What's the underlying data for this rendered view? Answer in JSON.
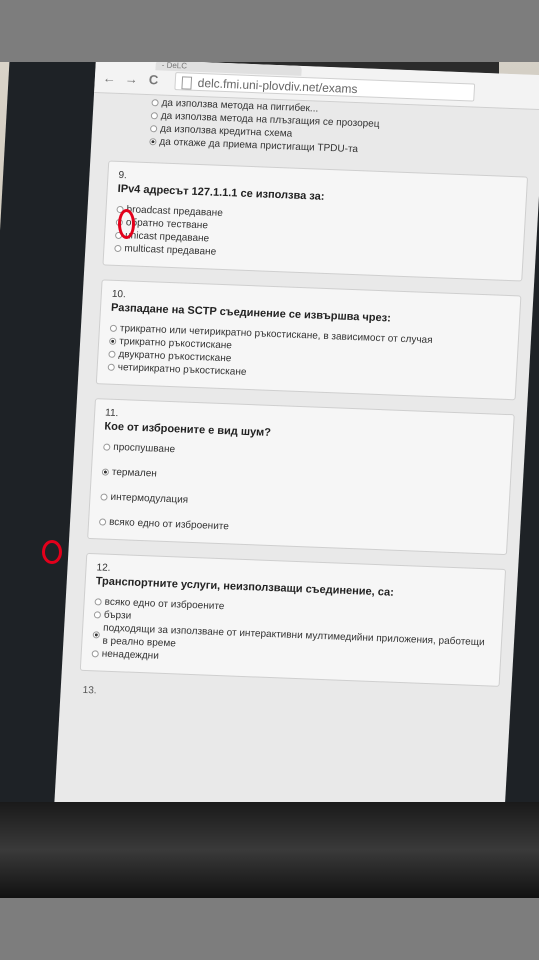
{
  "browser": {
    "tab_title": "- DeLC",
    "back_glyph": "←",
    "forward_glyph": "→",
    "reload_glyph": "C",
    "url": "delc.fmi.uni-plovdiv.net/exams"
  },
  "previous_question_options": [
    {
      "label": "да използва метода на пиггибек...",
      "checked": false
    },
    {
      "label": "да използва метода на плъзгащия се прозорец",
      "checked": false
    },
    {
      "label": "да използва кредитна схема",
      "checked": false
    },
    {
      "label": "да откаже да приема пристигащи TPDU-та",
      "checked": true
    }
  ],
  "questions": [
    {
      "number": "9.",
      "text": "IPv4 адресът 127.1.1.1 се използва за:",
      "options": [
        {
          "label": "broadcast предаване",
          "checked": false
        },
        {
          "label": "обратно тестване",
          "checked": false
        },
        {
          "label": "unicast предаване",
          "checked": false
        },
        {
          "label": "multicast предаване",
          "checked": false
        }
      ]
    },
    {
      "number": "10.",
      "text": "Разпадане на SCTP съединение се извършва чрез:",
      "options": [
        {
          "label": "трикратно или четирикратно ръкостискане, в зависимост от случая",
          "checked": false
        },
        {
          "label": "трикратно ръкостискане",
          "checked": true
        },
        {
          "label": "двукратно ръкостискане",
          "checked": false
        },
        {
          "label": "четирикратно ръкостискане",
          "checked": false
        }
      ]
    },
    {
      "number": "11.",
      "text": "Кое от изброените е вид шум?",
      "options": [
        {
          "label": "проспушване",
          "checked": false
        },
        {
          "label": "термален",
          "checked": true
        },
        {
          "label": "интермодулация",
          "checked": false
        },
        {
          "label": "всяко едно от изброените",
          "checked": false
        }
      ]
    },
    {
      "number": "12.",
      "text": "Транспортните услуги, неизползващи съединение, са:",
      "options": [
        {
          "label": "всяко едно от изброените",
          "checked": false
        },
        {
          "label": "бързи",
          "checked": false
        },
        {
          "label": "подходящи за използване от интерактивни мултимедийни приложения, работещи в реално време",
          "checked": true
        },
        {
          "label": "ненадеждни",
          "checked": false
        }
      ]
    }
  ],
  "next_question_number": "13.",
  "colors": {
    "annotation": "#e3001b",
    "taskbar": "#2a3f55"
  },
  "taskbar_icons": [
    "internet-explorer-icon",
    "folder-icon",
    "media-player-icon",
    "chrome-icon"
  ]
}
